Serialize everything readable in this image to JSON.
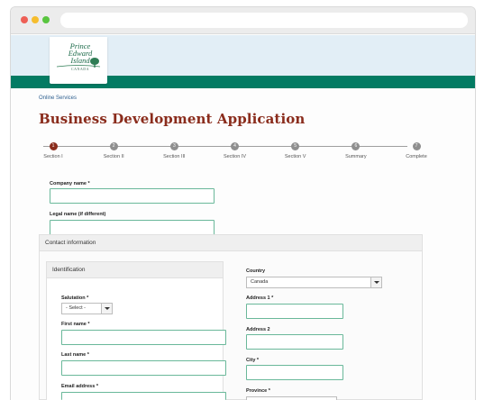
{
  "logo": {
    "line1": "Prince",
    "line2": "Edward",
    "line3": "Island",
    "line4": "CANADA"
  },
  "breadcrumb": "Online Services",
  "page_title": "Business Development Application",
  "steps": [
    {
      "number": "1",
      "label": "Section I",
      "active": true
    },
    {
      "number": "2",
      "label": "Section II",
      "active": false
    },
    {
      "number": "3",
      "label": "Section III",
      "active": false
    },
    {
      "number": "4",
      "label": "Section IV",
      "active": false
    },
    {
      "number": "5",
      "label": "Section V",
      "active": false
    },
    {
      "number": "6",
      "label": "Summary",
      "active": false
    },
    {
      "number": "7",
      "label": "Complete",
      "active": false
    }
  ],
  "form": {
    "company_name_label": "Company name *",
    "legal_name_label": "Legal name (if different)",
    "contact_section_title": "Contact information",
    "identification_title": "Identification",
    "salutation_label": "Salutation *",
    "salutation_value": "- Select -",
    "first_name_label": "First name *",
    "last_name_label": "Last name *",
    "email_label": "Email address *",
    "country_label": "Country",
    "country_value": "Canada",
    "address1_label": "Address 1 *",
    "address2_label": "Address 2",
    "city_label": "City *",
    "province_label": "Province *"
  },
  "colors": {
    "brand_green": "#037b63",
    "title_red": "#8a2c1c",
    "input_border": "#6ab89a",
    "header_bg": "#e2eef6"
  }
}
